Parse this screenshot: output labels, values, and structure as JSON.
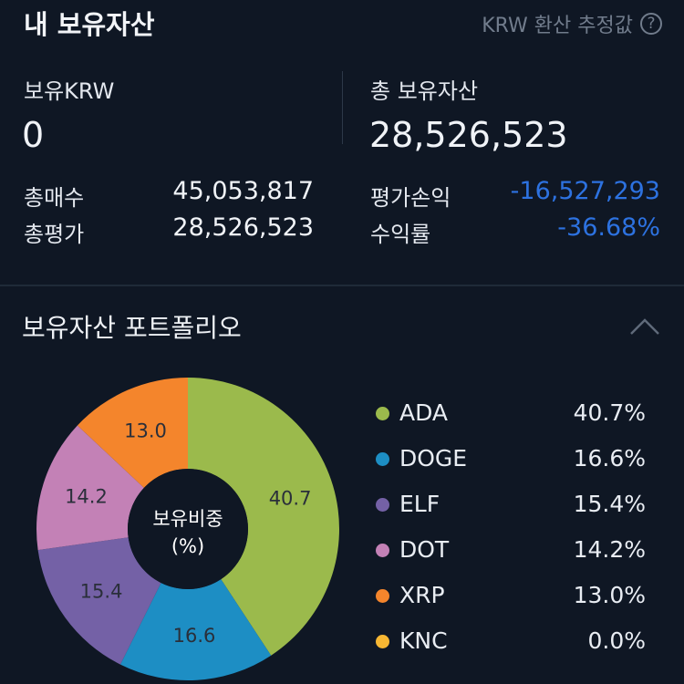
{
  "header": {
    "title": "내 보유자산",
    "krw_note": "KRW 환산 추정값",
    "help_icon": "help-circle-icon"
  },
  "summary": {
    "krw_label": "보유KRW",
    "krw_value": "0",
    "total_label": "총 보유자산",
    "total_value": "28,526,523",
    "buy_label": "총매수",
    "buy_value": "45,053,817",
    "eval_label": "총평가",
    "eval_value": "28,526,523",
    "pnl_label": "평가손익",
    "pnl_value": "-16,527,293",
    "rate_label": "수익률",
    "rate_value": "-36.68%",
    "negative_color": "#2d72e0"
  },
  "portfolio": {
    "title": "보유자산 포트폴리오",
    "collapse_icon": "chevron-up-icon",
    "center_line1": "보유비중",
    "center_line2": "(%)",
    "items": [
      {
        "name": "ADA",
        "percent": "40.7%",
        "value": 40.7,
        "slice_label": "40.7",
        "color": "#9bba4c"
      },
      {
        "name": "DOGE",
        "percent": "16.6%",
        "value": 16.6,
        "slice_label": "16.6",
        "color": "#1d8ec4"
      },
      {
        "name": "ELF",
        "percent": "15.4%",
        "value": 15.4,
        "slice_label": "15.4",
        "color": "#7461a6"
      },
      {
        "name": "DOT",
        "percent": "14.2%",
        "value": 14.2,
        "slice_label": "14.2",
        "color": "#c381b6"
      },
      {
        "name": "XRP",
        "percent": "13.0%",
        "value": 13.0,
        "slice_label": "13.0",
        "color": "#f4852c"
      },
      {
        "name": "KNC",
        "percent": "0.0%",
        "value": 0.0,
        "slice_label": "",
        "color": "#f7b733"
      }
    ]
  },
  "chart_data": {
    "type": "pie",
    "title": "",
    "categories": [
      "ADA",
      "DOGE",
      "ELF",
      "DOT",
      "XRP",
      "KNC"
    ],
    "values": [
      40.7,
      16.6,
      15.4,
      14.2,
      13.0,
      0.0
    ],
    "legend": "right"
  }
}
